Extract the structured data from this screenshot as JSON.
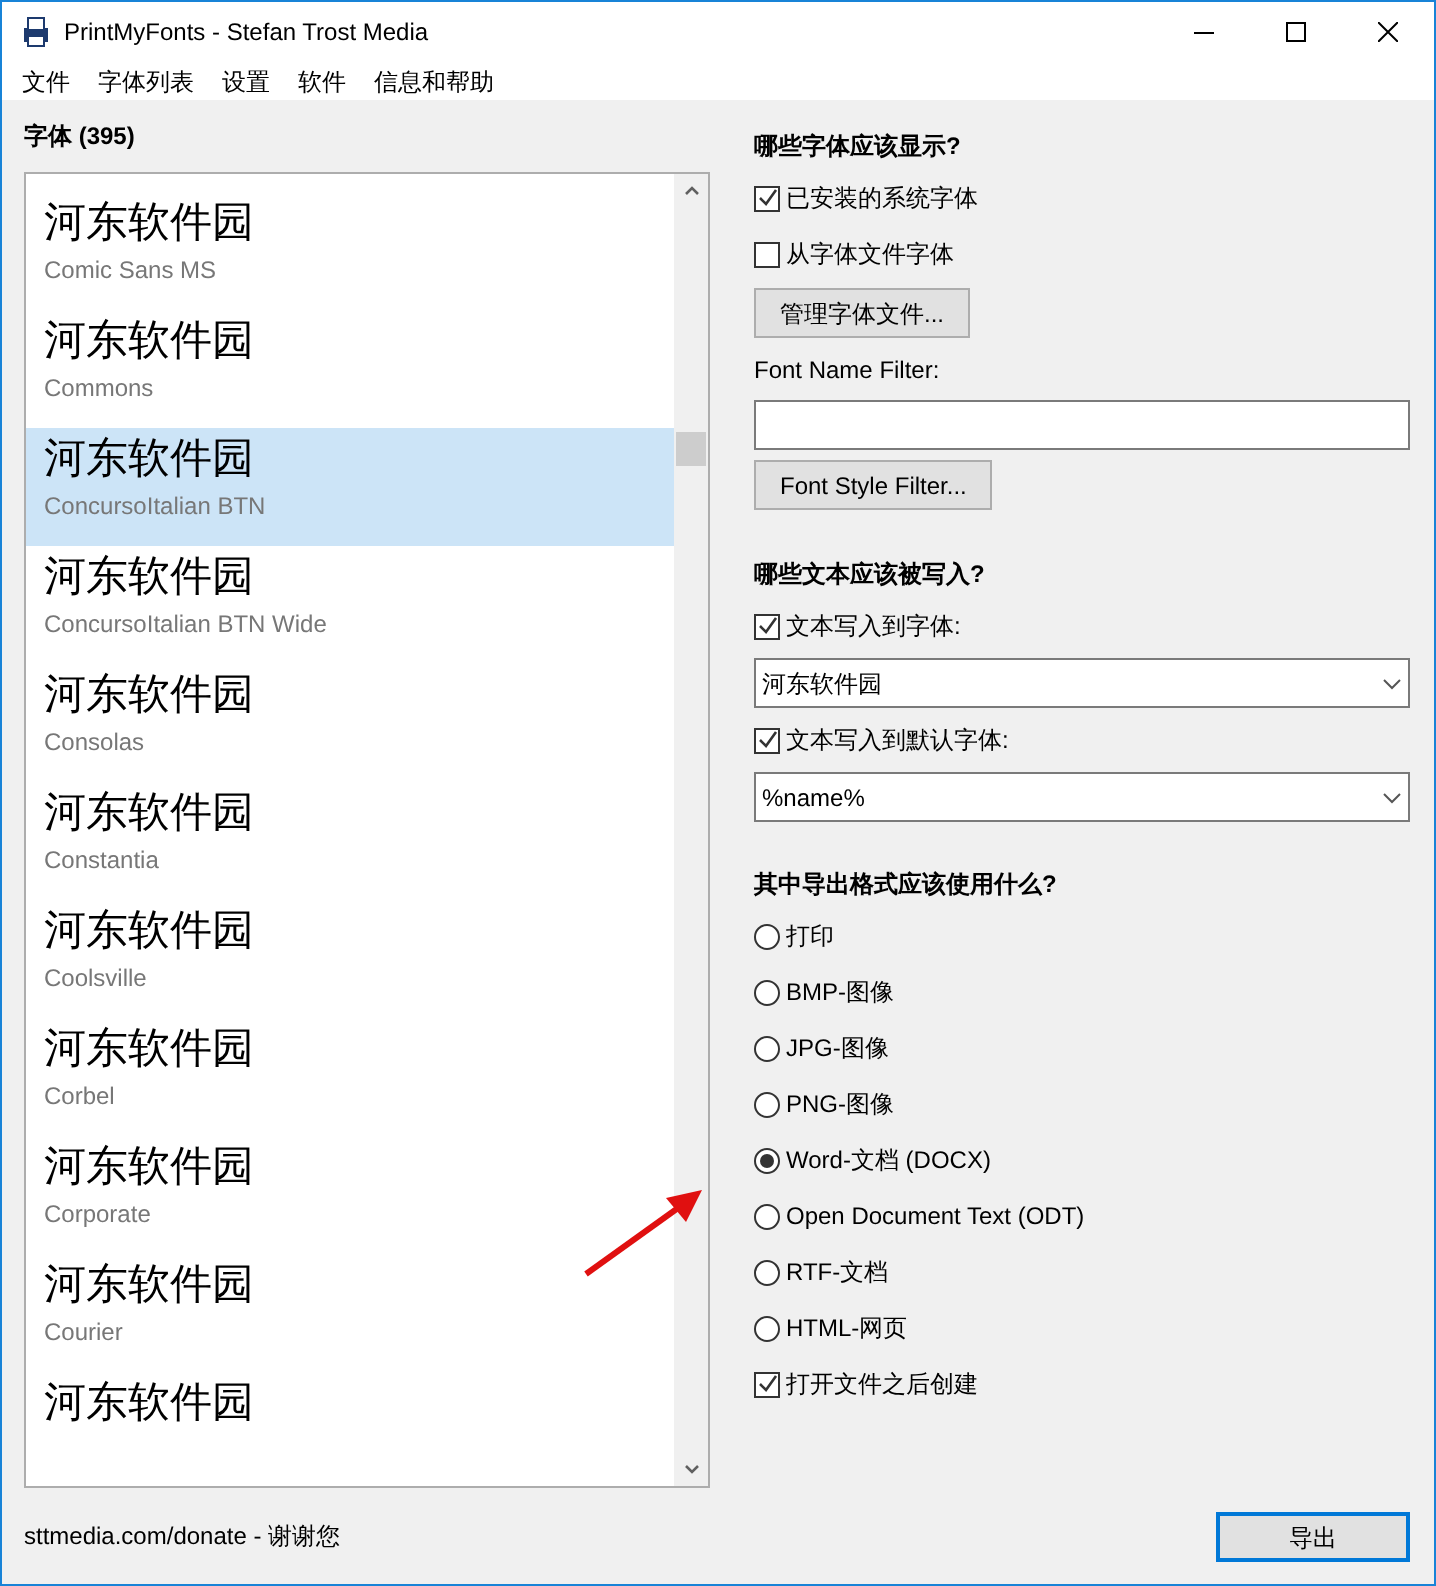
{
  "window": {
    "title": "PrintMyFonts - Stefan Trost Media"
  },
  "menu": [
    "文件",
    "字体列表",
    "设置",
    "软件",
    "信息和帮助"
  ],
  "font_list": {
    "heading": "字体 (395)",
    "items": [
      {
        "sample": "河东软件园",
        "name": "Comic Sans MS",
        "selected": false
      },
      {
        "sample": "河东软件园",
        "name": "Commons",
        "selected": false
      },
      {
        "sample": "河东软件园",
        "name": "ConcursoItalian BTN",
        "selected": true
      },
      {
        "sample": "河东软件园",
        "name": "ConcursoItalian BTN Wide",
        "selected": false
      },
      {
        "sample": "河东软件园",
        "name": "Consolas",
        "selected": false
      },
      {
        "sample": "河东软件园",
        "name": "Constantia",
        "selected": false
      },
      {
        "sample": "河东软件园",
        "name": "Coolsville",
        "selected": false
      },
      {
        "sample": "河东软件园",
        "name": "Corbel",
        "selected": false
      },
      {
        "sample": "河东软件园",
        "name": "Corporate",
        "selected": false
      },
      {
        "sample": "河东软件园",
        "name": "Courier",
        "selected": false
      },
      {
        "sample": "河东软件园",
        "selected": false
      }
    ]
  },
  "donate": "sttmedia.com/donate - 谢谢您",
  "sections": [
    {
      "heading": "哪些字体应该显示?",
      "controls": [
        {
          "kind": "checkbox",
          "label": "已安装的系统字体",
          "checked": true
        },
        {
          "kind": "checkbox",
          "label": "从字体文件字体",
          "checked": false
        },
        {
          "kind": "button",
          "label": "管理字体文件..."
        },
        {
          "kind": "label",
          "label": "Font Name Filter:"
        },
        {
          "kind": "input"
        },
        {
          "kind": "button",
          "label": "Font Style Filter..."
        }
      ]
    },
    {
      "heading": "哪些文本应该被写入?",
      "controls": [
        {
          "kind": "checkbox",
          "label": "文本写入到字体:",
          "checked": true
        },
        {
          "kind": "select",
          "value": "河东软件园"
        },
        {
          "kind": "checkbox",
          "label": "文本写入到默认字体:",
          "checked": true
        },
        {
          "kind": "select",
          "value": "%name%"
        }
      ]
    },
    {
      "heading": "其中导出格式应该使用什么?",
      "controls": [
        {
          "kind": "radio",
          "label": "打印",
          "selected": false
        },
        {
          "kind": "radio",
          "label": "BMP-图像",
          "selected": false
        },
        {
          "kind": "radio",
          "label": "JPG-图像",
          "selected": false
        },
        {
          "kind": "radio",
          "label": "PNG-图像",
          "selected": false
        },
        {
          "kind": "radio",
          "label": "Word-文档 (DOCX)",
          "selected": true
        },
        {
          "kind": "radio",
          "label": "Open Document Text (ODT)",
          "selected": false
        },
        {
          "kind": "radio",
          "label": "RTF-文档",
          "selected": false
        },
        {
          "kind": "radio",
          "label": "HTML-网页",
          "selected": false
        },
        {
          "kind": "checkbox",
          "label": "打开文件之后创建",
          "checked": true
        }
      ]
    }
  ],
  "export_button": "导出"
}
